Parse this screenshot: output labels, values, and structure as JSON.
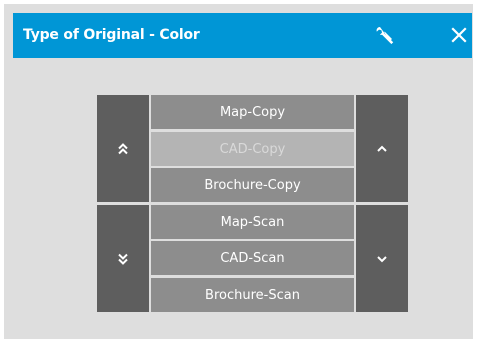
{
  "dialog": {
    "title": "Type of Original - Color",
    "accent_color": "#0096d6",
    "settings_icon": "wrench-icon",
    "close_icon": "close-icon"
  },
  "picker": {
    "items": [
      {
        "label": "Map-Copy",
        "enabled": true
      },
      {
        "label": "CAD-Copy",
        "enabled": false
      },
      {
        "label": "Brochure-Copy",
        "enabled": true
      },
      {
        "label": "Map-Scan",
        "enabled": true
      },
      {
        "label": "CAD-Scan",
        "enabled": true
      },
      {
        "label": "Brochure-Scan",
        "enabled": true
      }
    ],
    "scroll_buttons": {
      "page_up": "double-chevron-up-icon",
      "page_down": "double-chevron-down-icon",
      "up": "chevron-up-icon",
      "down": "chevron-down-icon"
    }
  }
}
